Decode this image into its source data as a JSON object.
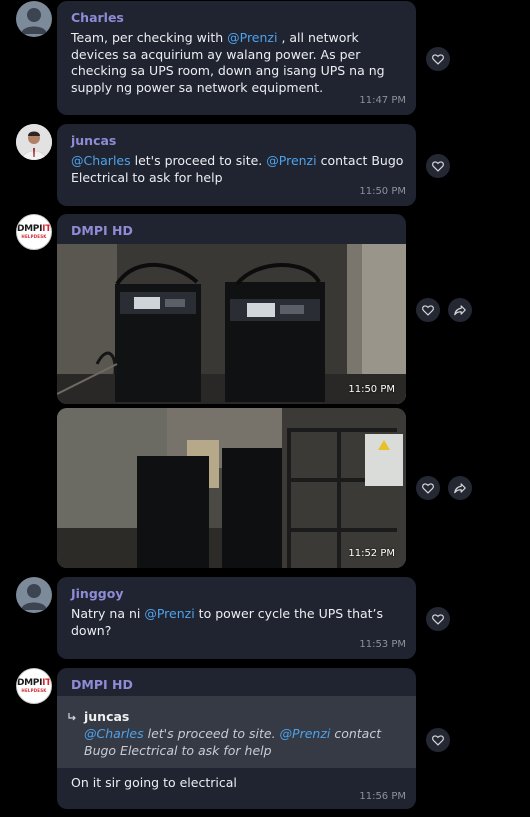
{
  "messages": [
    {
      "sender": "Charles",
      "text_parts": [
        "Team, per checking with ",
        "@Prenzi",
        " , all network devices sa acquirium ay walang power. As per checking sa UPS room, down ang isang UPS na ng supply ng power sa network equipment."
      ],
      "time": "11:47 PM"
    },
    {
      "sender": "juncas",
      "text_parts": [
        "@Charles",
        " let's proceed to site. ",
        "@Prenzi",
        "  contact Bugo Electrical to ask for help"
      ],
      "time": "11:50 PM"
    },
    {
      "sender": "DMPI HD",
      "photos": [
        {
          "time": "11:50 PM",
          "alt": "Two black UPS cabinets with control panels in a dim room"
        },
        {
          "time": "11:52 PM",
          "alt": "UPS units and metal battery rack with electrical box on wall"
        }
      ]
    },
    {
      "sender": "Jinggoy",
      "text_parts": [
        "Natry na ni ",
        "@Prenzi",
        " to power cycle the UPS that’s down?"
      ],
      "time": "11:53 PM"
    },
    {
      "sender": "DMPI HD",
      "quote": {
        "name": "juncas",
        "text_parts": [
          "@Charles",
          " let's proceed to site. ",
          "@Prenzi",
          "  contact Bugo Electrical to ask for help"
        ]
      },
      "text": "On it sir going to electrical",
      "time": "11:56 PM"
    }
  ],
  "logo": {
    "top_a": "DMPI",
    "top_b": "IT",
    "bottom": "HELPDESK"
  },
  "icons": {
    "react": "heart-outline-icon",
    "forward": "share-arrow-icon",
    "reply": "reply-arrow-icon",
    "avatar_default": "person-silhouette-icon"
  },
  "colors": {
    "bubble": "#1f2430",
    "sender": "#8f8bd6",
    "mention": "#4ea2ea",
    "quote_bg": "#353a45",
    "background": "#000000"
  }
}
